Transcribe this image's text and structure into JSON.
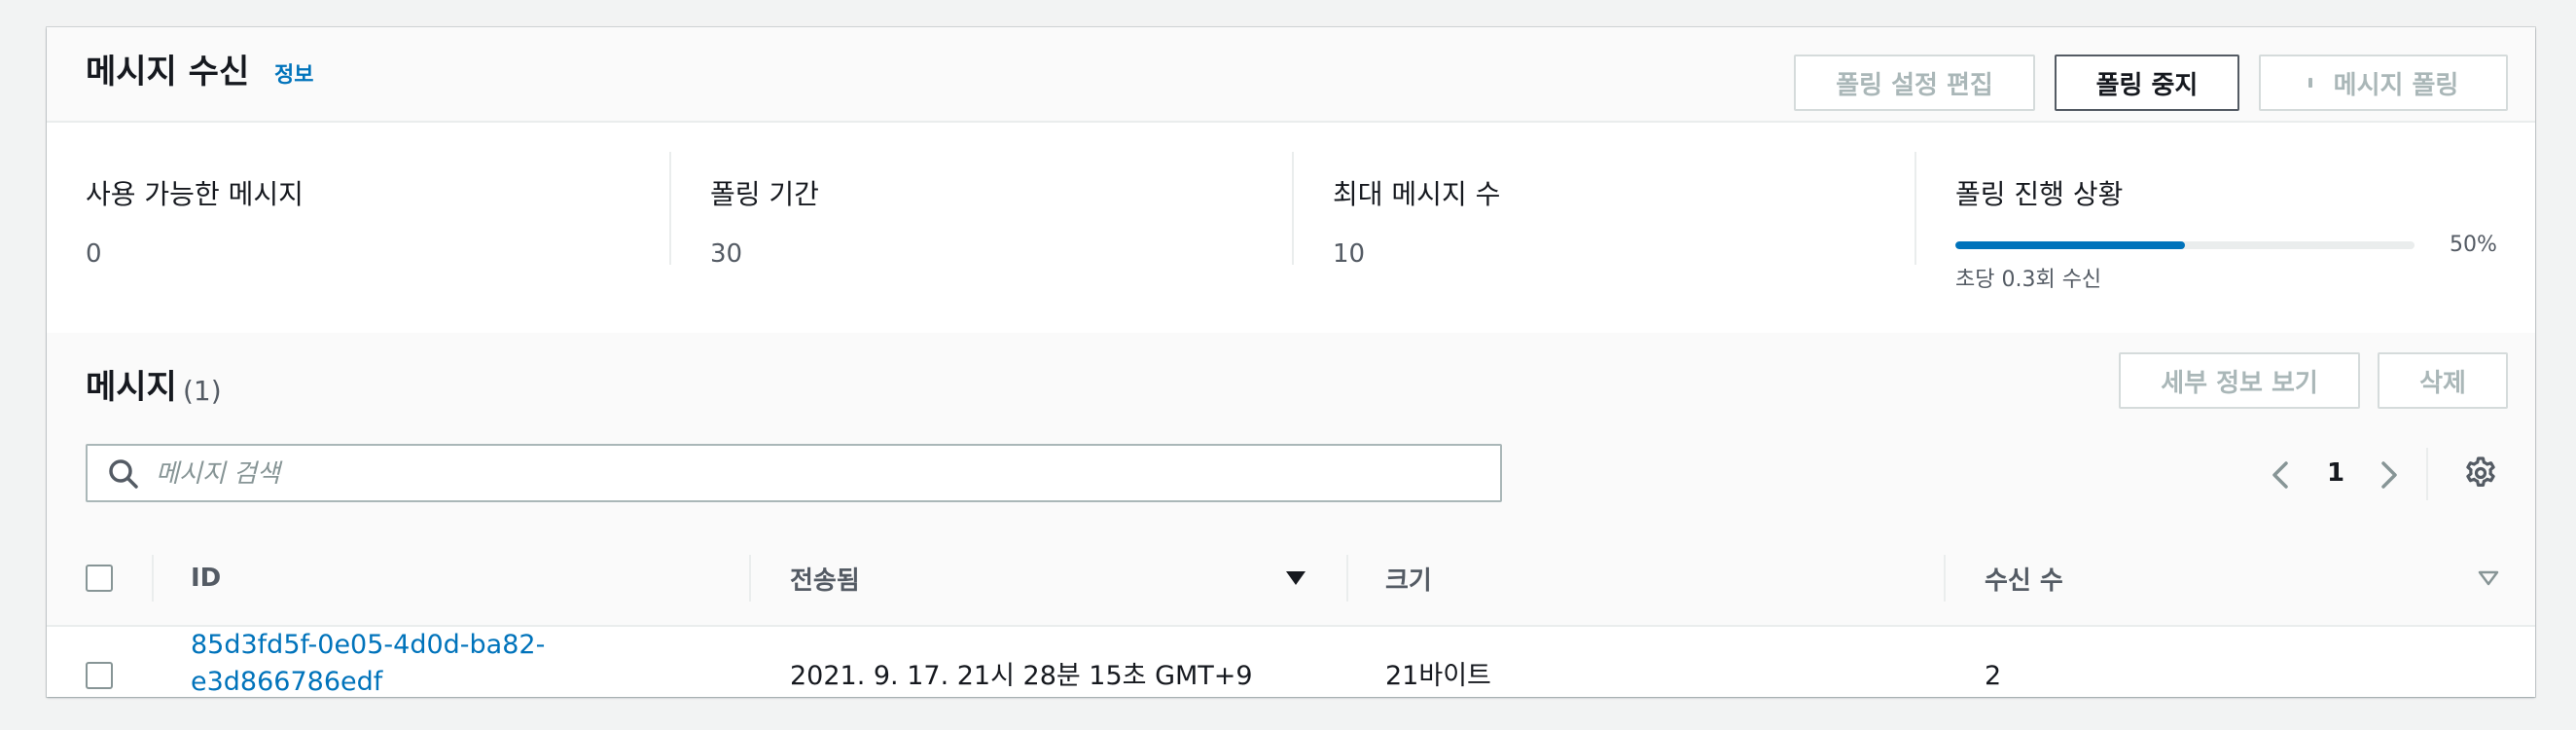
{
  "header": {
    "title": "메시지 수신",
    "info_link": "정보",
    "buttons": {
      "edit_poll": "폴링 설정 편집",
      "stop_poll": "폴링 중지",
      "poll_messages": "메시지 폴링"
    }
  },
  "stats": {
    "available": {
      "label": "사용 가능한 메시지",
      "value": "0"
    },
    "duration": {
      "label": "폴링 기간",
      "value": "30"
    },
    "max_messages": {
      "label": "최대 메시지 수",
      "value": "10"
    },
    "progress": {
      "label": "폴링 진행 상황",
      "percent": 50,
      "percent_text": "50%",
      "rate_text": "초당 0.3회 수신"
    }
  },
  "messages": {
    "title": "메시지",
    "count": "(1)",
    "buttons": {
      "view_details": "세부 정보 보기",
      "delete": "삭제"
    },
    "search": {
      "placeholder": "메시지 검색"
    },
    "pagination": {
      "current_page": "1"
    }
  },
  "table": {
    "columns": [
      "ID",
      "전송됨",
      "크기",
      "수신 수"
    ],
    "rows": [
      {
        "id_line1": "85d3fd5f-0e05-4d0d-ba82-",
        "id_line2": "e3d866786edf",
        "sent": "2021. 9. 17. 21시 28분 15초 GMT+9",
        "size": "21바이트",
        "receive_count": "2"
      }
    ]
  },
  "colors": {
    "link": "#0073bb",
    "progress": "#0073bb",
    "border": "#aab7b8",
    "divider": "#eaeded"
  },
  "icons": [
    "search-icon",
    "chevron-left-icon",
    "chevron-right-icon",
    "gear-icon",
    "sort-descending-icon",
    "sort-icon"
  ]
}
